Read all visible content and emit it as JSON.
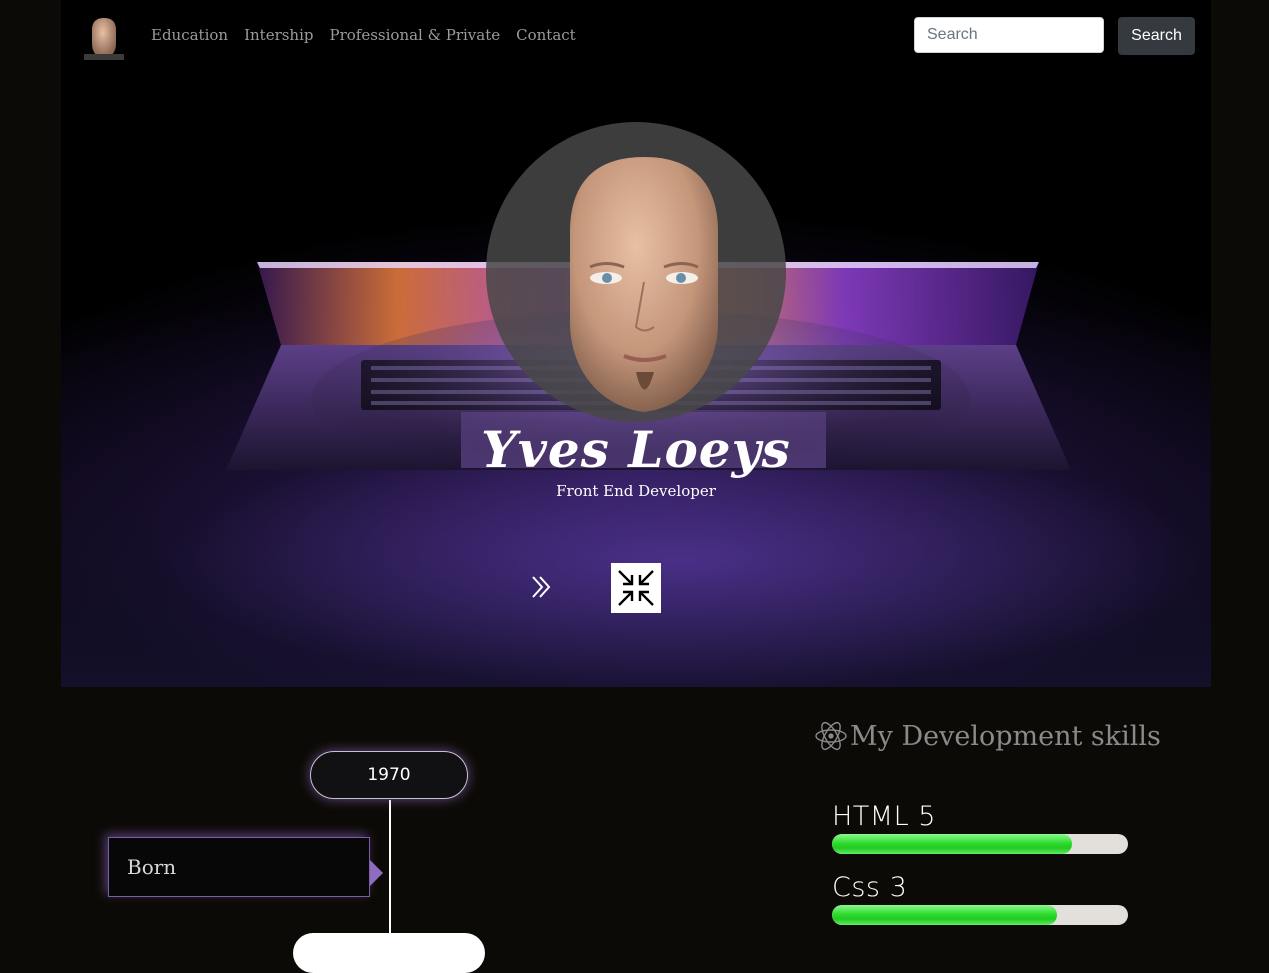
{
  "nav": {
    "links": [
      "Education",
      "Intership",
      "Professional & Private",
      "Contact"
    ],
    "search_placeholder": "Search",
    "search_button": "Search"
  },
  "hero": {
    "name": "Yves Loeys",
    "subtitle": "Front End Developer"
  },
  "timeline": {
    "year": "1970",
    "event": "Born"
  },
  "skills": {
    "title": "My Development skills",
    "items": [
      {
        "label": "HTML 5",
        "level": 0.81
      },
      {
        "label": "Css 3",
        "level": 0.76
      }
    ],
    "bar_color": "#2fdc2f"
  }
}
